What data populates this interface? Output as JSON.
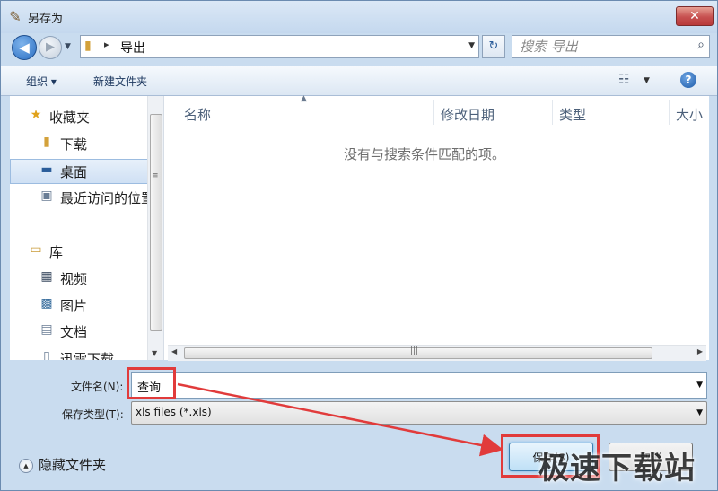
{
  "window": {
    "title": "另存为",
    "close_glyph": "✕",
    "app_icon": "save-as-app-icon"
  },
  "navigation": {
    "back_glyph": "◀",
    "forward_glyph": "▶",
    "history_dropdown_glyph": "▼",
    "address": {
      "folder_icon": "folder-icon",
      "separator": "▸",
      "crumb": "导出",
      "dropdown_glyph": "▼"
    },
    "refresh_glyph": "↻",
    "search": {
      "placeholder": "搜索 导出",
      "icon": "search-icon",
      "glyph": "⌕"
    }
  },
  "toolbar": {
    "organize": "组织 ▾",
    "new_folder": "新建文件夹",
    "view_glyph": "☷",
    "view_dropdown_glyph": "▼",
    "help_glyph": "?"
  },
  "sidebar": {
    "items": [
      {
        "label": "收藏夹",
        "icon": "star-icon",
        "glyph": "★",
        "selected": false
      },
      {
        "label": "下载",
        "icon": "downloads-folder-icon",
        "glyph": "▮",
        "selected": false
      },
      {
        "label": "桌面",
        "icon": "desktop-icon",
        "glyph": "▬",
        "selected": true
      },
      {
        "label": "最近访问的位置",
        "icon": "recent-places-icon",
        "glyph": "▣",
        "selected": false
      },
      {
        "label": "库",
        "icon": "library-icon",
        "glyph": "▭",
        "selected": false
      },
      {
        "label": "视频",
        "icon": "video-icon",
        "glyph": "▦",
        "selected": false
      },
      {
        "label": "图片",
        "icon": "pictures-icon",
        "glyph": "▩",
        "selected": false
      },
      {
        "label": "文档",
        "icon": "documents-icon",
        "glyph": "▤",
        "selected": false
      },
      {
        "label": "迅雷下载",
        "icon": "thunder-download-icon",
        "glyph": "▯",
        "selected": false
      }
    ]
  },
  "file_list": {
    "columns": [
      "名称",
      "修改日期",
      "类型",
      "大小"
    ],
    "sort_glyph": "▲",
    "empty_message": "没有与搜索条件匹配的项。"
  },
  "scrollbars": {
    "grip": "≡",
    "down": "▼",
    "left": "◀",
    "right": "▶",
    "hgrip": "|||"
  },
  "form": {
    "file_name_label": "文件名(N):",
    "file_name_value": "查询",
    "file_name_dropdown": "▼",
    "file_type_label": "保存类型(T):",
    "file_type_value": "xls files (*.xls)",
    "file_type_dropdown": "▼"
  },
  "footer": {
    "hide_folders": "隐藏文件夹",
    "hide_glyph": "▲",
    "save": "保存(S)",
    "cancel": "取消"
  },
  "annotation": {
    "color": "#e13b3b"
  },
  "watermark": {
    "text": "极速下载站"
  }
}
